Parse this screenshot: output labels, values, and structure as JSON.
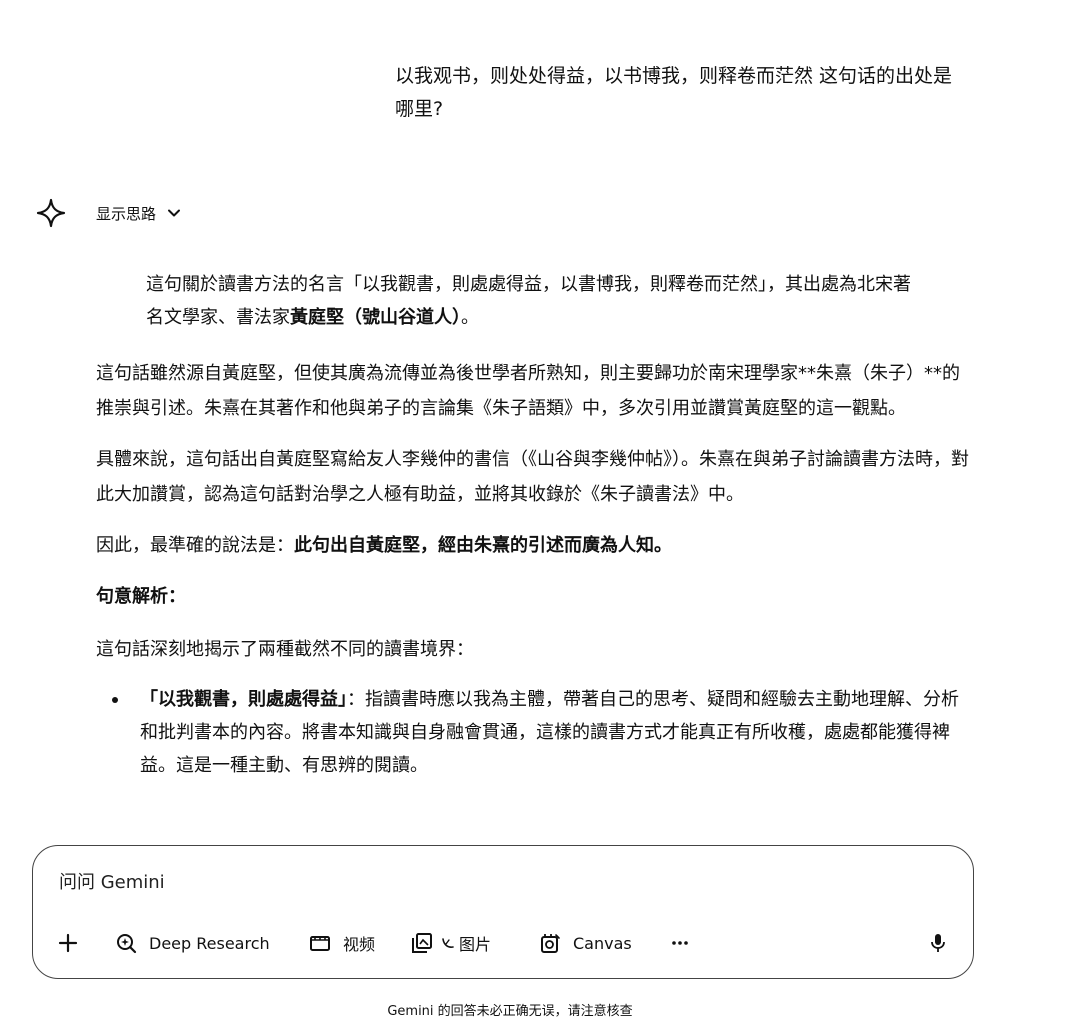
{
  "user_message": "以我观书，则处处得益，以书博我，则释卷而茫然 这句话的出处是哪里?",
  "thinking": {
    "label": "显示思路"
  },
  "response": {
    "quote_pre": "這句關於讀書方法的名言「以我觀書，則處處得益，以書博我，則釋卷而茫然」，其出處為北宋著名文學家、書法家",
    "quote_bold": "黃庭堅（號山谷道人）",
    "quote_post": "。",
    "para1": "這句話雖然源自黃庭堅，但使其廣為流傳並為後世學者所熟知，則主要歸功於南宋理學家**朱熹（朱子）**的推崇與引述。朱熹在其著作和他與弟子的言論集《朱子語類》中，多次引用並讚賞黃庭堅的這一觀點。",
    "para2": "具體來說，這句話出自黃庭堅寫給友人李幾仲的書信（《山谷與李幾仲帖》）。朱熹在與弟子討論讀書方法時，對此大加讚賞，認為這句話對治學之人極有助益，並將其收錄於《朱子讀書法》中。",
    "para3_pre": "因此，最準確的說法是：",
    "para3_bold": "此句出自黃庭堅，經由朱熹的引述而廣為人知。",
    "heading": "句意解析：",
    "para4": "這句話深刻地揭示了兩種截然不同的讀書境界：",
    "bullet1_bold": "「以我觀書，則處處得益」",
    "bullet1_text": "：指讀書時應以我為主體，帶著自己的思考、疑問和經驗去主動地理解、分析和批判書本的內容。將書本知識與自身融會貫通，這樣的讀書方式才能真正有所收穫，處處都能獲得裨益。這是一種主動、有思辨的閱讀。"
  },
  "input": {
    "placeholder": "问问 Gemini"
  },
  "toolbar": {
    "add_icon": "plus-icon",
    "deep_research_label": "Deep Research",
    "video_label": "视频",
    "image_label": "图片",
    "canvas_label": "Canvas",
    "more_icon": "more-horizontal-icon",
    "mic_icon": "microphone-icon"
  },
  "disclaimer": "Gemini 的回答未必正确无误，请注意核查"
}
